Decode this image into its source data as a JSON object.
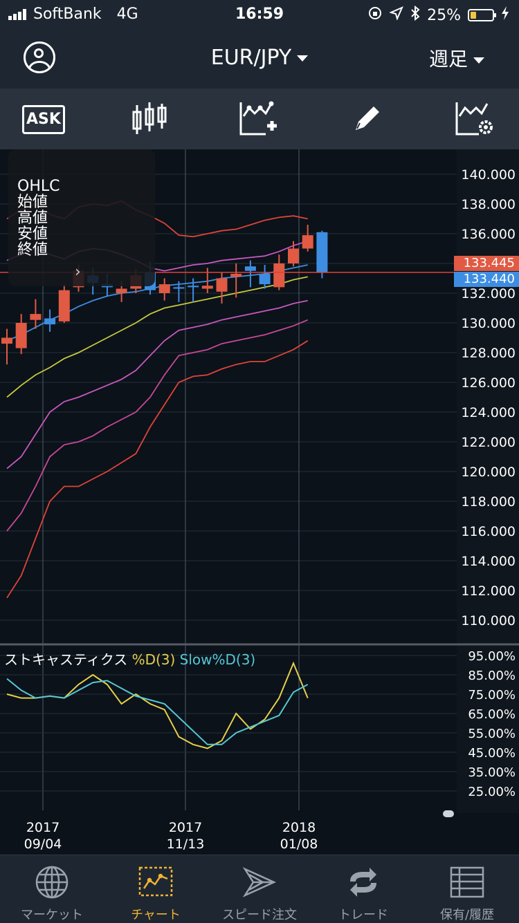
{
  "status": {
    "carrier": "SoftBank",
    "network": "4G",
    "time": "16:59",
    "battery": "25%"
  },
  "nav": {
    "pair": "EUR/JPY",
    "period": "週足"
  },
  "toolbar": {
    "ask_label": "ASK"
  },
  "ohlc": {
    "title": "OHLC",
    "open": "始値",
    "high": "高値",
    "low": "安値",
    "close": "終値"
  },
  "prices": {
    "ask": "133.445",
    "bid": "133.440"
  },
  "stoch": {
    "name": "ストキャスティクス",
    "d": "%D(3)",
    "slow": "Slow%D(3)"
  },
  "dates": [
    {
      "year": "2017",
      "day": "09/04"
    },
    {
      "year": "2017",
      "day": "11/13"
    },
    {
      "year": "2018",
      "day": "01/08"
    }
  ],
  "tabs": [
    {
      "label": "マーケット",
      "icon": "globe-icon"
    },
    {
      "label": "チャート",
      "icon": "chart-icon"
    },
    {
      "label": "スピード注文",
      "icon": "speed-order-icon"
    },
    {
      "label": "トレード",
      "icon": "trade-icon"
    },
    {
      "label": "保有/履歴",
      "icon": "history-icon"
    }
  ],
  "chart_data": [
    {
      "type": "candlestick",
      "y_ticks": [
        "140.000",
        "138.000",
        "136.000",
        "134.000",
        "132.000",
        "130.000",
        "128.000",
        "126.000",
        "124.000",
        "122.000",
        "120.000",
        "118.000",
        "116.000",
        "114.000",
        "112.000",
        "110.000"
      ],
      "ylim": [
        109.0,
        141.0
      ],
      "candles": [
        {
          "o": 128.6,
          "h": 129.6,
          "l": 127.2,
          "c": 129.0
        },
        {
          "o": 128.3,
          "h": 130.6,
          "l": 127.9,
          "c": 130.0
        },
        {
          "o": 130.2,
          "h": 131.6,
          "l": 129.6,
          "c": 130.6
        },
        {
          "o": 130.3,
          "h": 130.9,
          "l": 129.4,
          "c": 129.9
        },
        {
          "o": 130.1,
          "h": 132.6,
          "l": 130.0,
          "c": 132.2
        },
        {
          "o": 132.4,
          "h": 133.9,
          "l": 132.1,
          "c": 133.5
        },
        {
          "o": 133.2,
          "h": 133.7,
          "l": 131.9,
          "c": 132.7
        },
        {
          "o": 132.6,
          "h": 133.3,
          "l": 131.8,
          "c": 132.4
        },
        {
          "o": 132.0,
          "h": 132.8,
          "l": 131.4,
          "c": 132.3
        },
        {
          "o": 132.3,
          "h": 133.6,
          "l": 132.0,
          "c": 133.2
        },
        {
          "o": 133.4,
          "h": 134.1,
          "l": 131.9,
          "c": 132.2
        },
        {
          "o": 132.0,
          "h": 133.0,
          "l": 131.5,
          "c": 132.6
        },
        {
          "o": 132.4,
          "h": 132.8,
          "l": 131.4,
          "c": 132.3
        },
        {
          "o": 132.5,
          "h": 133.0,
          "l": 131.4,
          "c": 132.4
        },
        {
          "o": 132.3,
          "h": 133.7,
          "l": 132.0,
          "c": 132.5
        },
        {
          "o": 132.1,
          "h": 133.4,
          "l": 131.3,
          "c": 133.0
        },
        {
          "o": 133.1,
          "h": 134.0,
          "l": 131.7,
          "c": 133.3
        },
        {
          "o": 133.8,
          "h": 134.2,
          "l": 132.4,
          "c": 133.5
        },
        {
          "o": 133.3,
          "h": 133.9,
          "l": 132.3,
          "c": 132.6
        },
        {
          "o": 132.4,
          "h": 134.6,
          "l": 132.2,
          "c": 134.0
        },
        {
          "o": 134.0,
          "h": 135.5,
          "l": 133.8,
          "c": 135.0
        },
        {
          "o": 135.0,
          "h": 136.6,
          "l": 134.8,
          "c": 135.9
        },
        {
          "o": 136.1,
          "h": 136.2,
          "l": 133.0,
          "c": 133.4
        }
      ],
      "lines": [
        {
          "color": "#e0433a",
          "values": [
            111.5,
            113.0,
            115.5,
            118.0,
            119.0,
            119.0,
            119.5,
            120.0,
            120.6,
            121.2,
            123.0,
            124.5,
            126.0,
            126.4,
            126.5,
            126.9,
            127.2,
            127.4,
            127.4,
            127.8,
            128.2,
            128.8
          ]
        },
        {
          "color": "#c8489a",
          "values": [
            116.0,
            117.2,
            119.0,
            121.0,
            121.8,
            122.0,
            122.4,
            123.0,
            123.5,
            124.0,
            125.0,
            126.5,
            127.8,
            128.0,
            128.2,
            128.6,
            128.8,
            129.0,
            129.2,
            129.5,
            129.8,
            130.2
          ]
        },
        {
          "color": "#c858c0",
          "values": [
            120.2,
            121.0,
            122.5,
            124.0,
            124.7,
            125.0,
            125.4,
            125.8,
            126.2,
            126.8,
            127.8,
            128.8,
            129.5,
            129.7,
            129.9,
            130.2,
            130.4,
            130.6,
            130.8,
            131.0,
            131.3,
            131.5
          ]
        },
        {
          "color": "#c8c840",
          "values": [
            125.0,
            125.8,
            126.5,
            127.0,
            127.6,
            128.0,
            128.5,
            129.0,
            129.5,
            130.0,
            130.6,
            131.0,
            131.2,
            131.4,
            131.6,
            131.8,
            132.0,
            132.2,
            132.4,
            132.6,
            132.9,
            133.1
          ]
        },
        {
          "color": "#3d8ee3",
          "values": [
            128.8,
            129.2,
            129.7,
            130.2,
            130.6,
            131.1,
            131.5,
            131.8,
            132.0,
            132.1,
            132.3,
            132.5,
            132.6,
            132.7,
            132.8,
            133.0,
            133.1,
            133.2,
            133.3,
            133.5,
            133.7,
            133.9
          ]
        },
        {
          "color": "#c858c0",
          "values": [
            134.2,
            134.6,
            135.0,
            134.6,
            134.3,
            134.8,
            135.0,
            134.9,
            134.6,
            134.2,
            133.7,
            133.5,
            133.7,
            133.9,
            134.0,
            134.2,
            134.3,
            134.4,
            134.5,
            134.8,
            135.2,
            135.5
          ]
        },
        {
          "color": "#e0433a",
          "values": [
            137.0,
            137.6,
            138.0,
            137.3,
            137.0,
            137.8,
            138.0,
            137.9,
            138.2,
            137.6,
            137.2,
            136.7,
            135.9,
            135.8,
            136.0,
            136.2,
            136.3,
            136.6,
            136.9,
            137.1,
            137.2,
            137.0
          ]
        }
      ]
    },
    {
      "type": "line",
      "y_ticks": [
        "95.00%",
        "85.00%",
        "75.00%",
        "65.00%",
        "55.00%",
        "45.00%",
        "35.00%",
        "25.00%"
      ],
      "ylim": [
        15,
        100
      ],
      "series": [
        {
          "name": "%D(3)",
          "color": "#e6cf4a",
          "values": [
            75,
            73,
            73,
            74,
            73,
            80,
            85,
            80,
            70,
            75,
            70,
            67,
            53,
            49,
            47,
            51,
            65,
            57,
            62,
            73,
            91,
            73
          ]
        },
        {
          "name": "Slow%D(3)",
          "color": "#55c7d6",
          "values": [
            83,
            77,
            73,
            74,
            73,
            77,
            81,
            82,
            78,
            74,
            72,
            70,
            63,
            56,
            49,
            49,
            55,
            58,
            61,
            64,
            76,
            80
          ]
        }
      ]
    }
  ]
}
